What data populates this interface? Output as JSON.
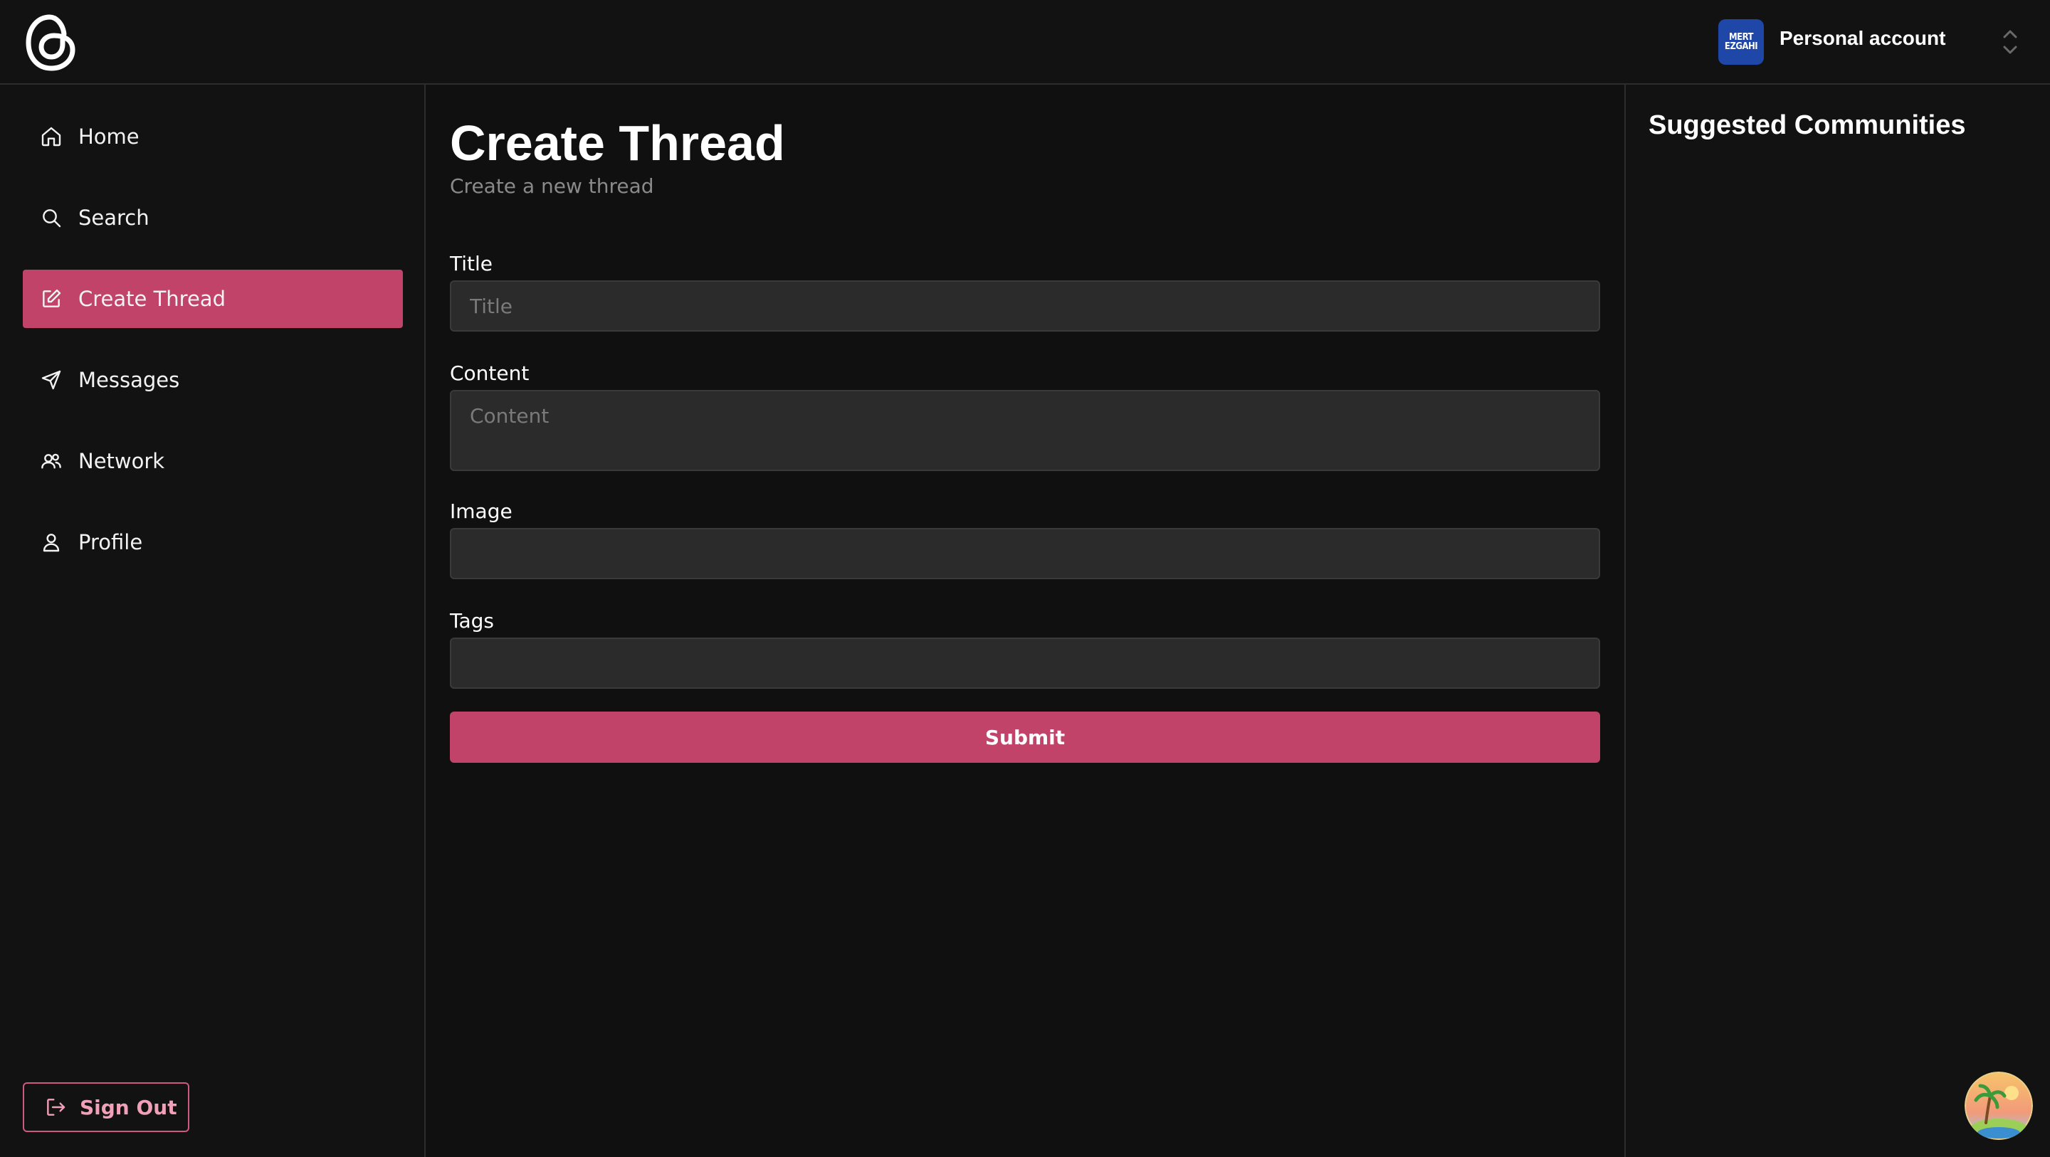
{
  "header": {
    "logo_icon": "threads-logo-icon",
    "account": {
      "avatar_lines": [
        "MERT",
        "EZGAHI"
      ],
      "name": "Personal account",
      "switcher_icon": "chevron-up-down-icon"
    }
  },
  "sidebar": {
    "items": [
      {
        "label": "Home",
        "icon": "home-icon",
        "active": false
      },
      {
        "label": "Search",
        "icon": "search-icon",
        "active": false
      },
      {
        "label": "Create Thread",
        "icon": "edit-icon",
        "active": true
      },
      {
        "label": "Messages",
        "icon": "send-icon",
        "active": false
      },
      {
        "label": "Network",
        "icon": "users-icon",
        "active": false
      },
      {
        "label": "Profile",
        "icon": "user-icon",
        "active": false
      }
    ],
    "sign_out_label": "Sign Out",
    "sign_out_icon": "logout-icon"
  },
  "main": {
    "title": "Create Thread",
    "subtitle": "Create a new thread",
    "fields": {
      "title": {
        "label": "Title",
        "placeholder": "Title",
        "value": ""
      },
      "content": {
        "label": "Content",
        "placeholder": "Content",
        "value": ""
      },
      "image": {
        "label": "Image",
        "placeholder": "",
        "value": ""
      },
      "tags": {
        "label": "Tags",
        "placeholder": "",
        "value": ""
      }
    },
    "submit_label": "Submit"
  },
  "right_panel": {
    "title": "Suggested Communities"
  },
  "colors": {
    "accent": "#c2436a",
    "background": "#101010",
    "panel": "#121212",
    "input_bg": "#2b2b2b"
  }
}
